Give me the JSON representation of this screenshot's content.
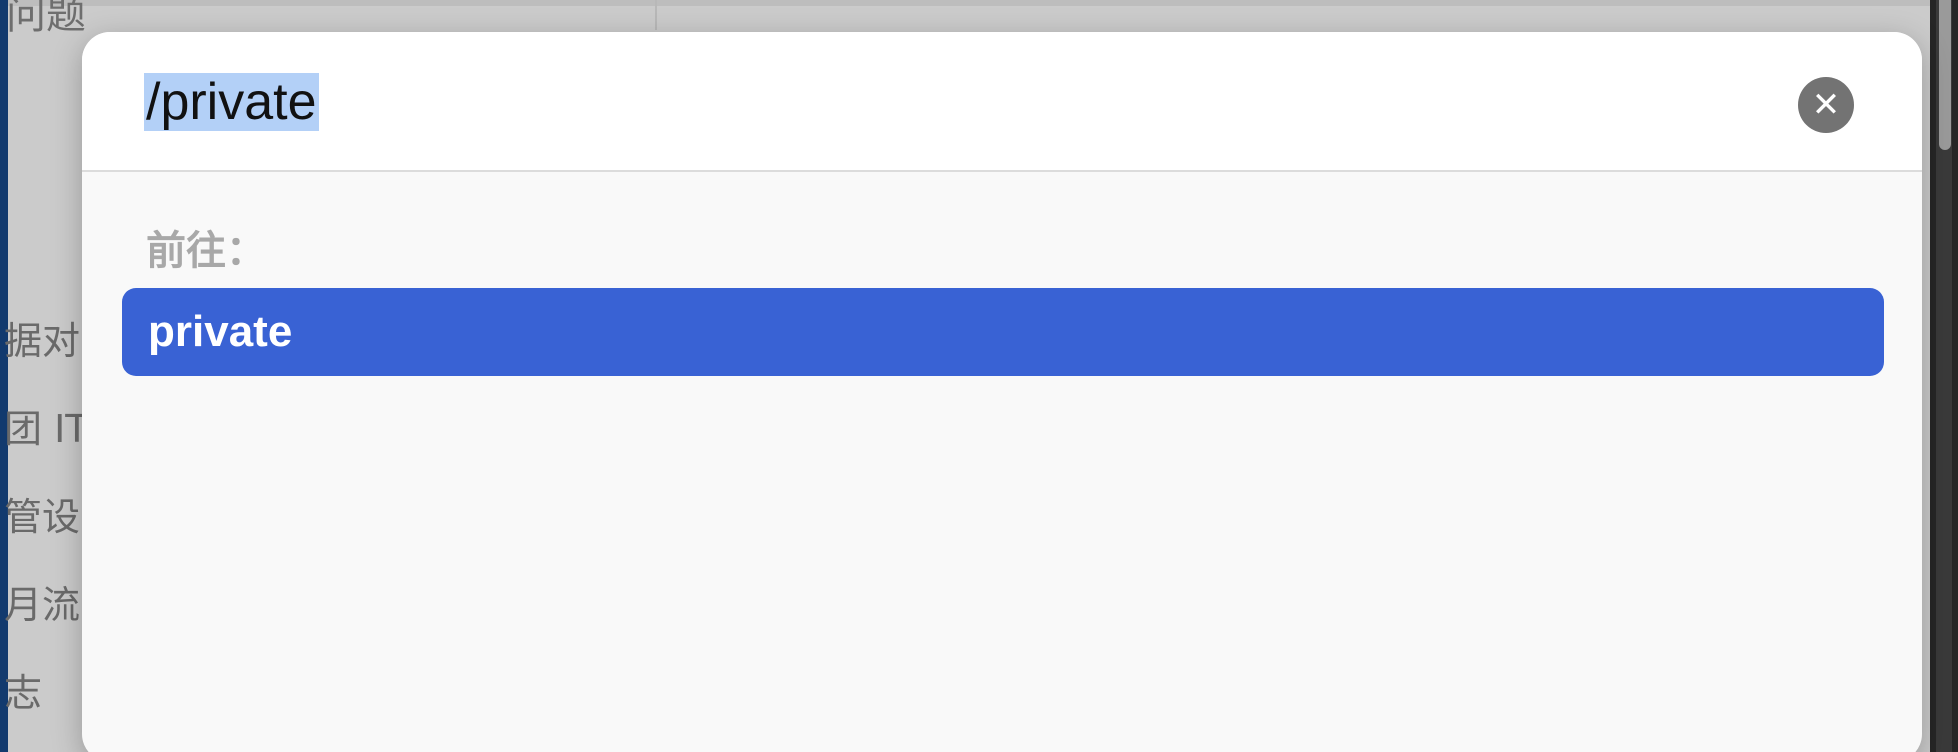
{
  "background": {
    "title_fragment": "问题",
    "sidebar_items": [
      "据对",
      "团 IT",
      "管设",
      "月流",
      "志"
    ]
  },
  "dialog": {
    "path_value": "/private",
    "clear_icon": "xmark-circle-fill",
    "goto_label": "前往：",
    "results": [
      {
        "label": "private",
        "selected": true
      }
    ]
  },
  "colors": {
    "accent": "#3962d4",
    "text_selection": "#b3d0f7",
    "clear_button": "#737373",
    "dialog_bg": "#f9f9f9"
  }
}
